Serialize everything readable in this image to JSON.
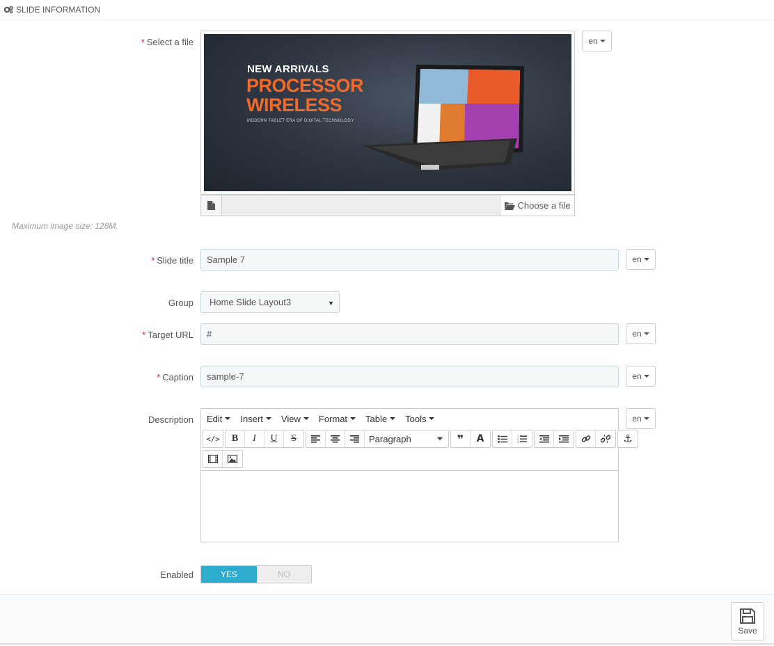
{
  "panel": {
    "title": "SLIDE INFORMATION",
    "icon": "cogs-icon"
  },
  "fields": {
    "file": {
      "label": "Select a file",
      "choose_label": "Choose a file",
      "hint": "Maximum image size: 128M."
    },
    "slide_title": {
      "label": "Slide title",
      "value": "Sample 7"
    },
    "group": {
      "label": "Group",
      "value": "Home Slide Layout3"
    },
    "target_url": {
      "label": "Target URL",
      "value": "#"
    },
    "caption": {
      "label": "Caption",
      "value": "sample-7"
    },
    "description": {
      "label": "Description"
    },
    "enabled": {
      "label": "Enabled",
      "yes": "YES",
      "no": "NO",
      "value": "YES"
    }
  },
  "lang": "en",
  "banner": {
    "line1": "NEW ARRIVALS",
    "line2": "PROCESSOR",
    "line3": "WIRELESS",
    "line4": "MODERN TABLET ERA OF DIGITAL TECHNOLOGY"
  },
  "editor": {
    "menu": [
      "Edit",
      "Insert",
      "View",
      "Format",
      "Table",
      "Tools"
    ],
    "format_select": "Paragraph"
  },
  "footer": {
    "save_label": "Save"
  },
  "colors": {
    "accent": "#2eacce",
    "required": "#e50b70",
    "banner_orange": "#f26a2a"
  }
}
